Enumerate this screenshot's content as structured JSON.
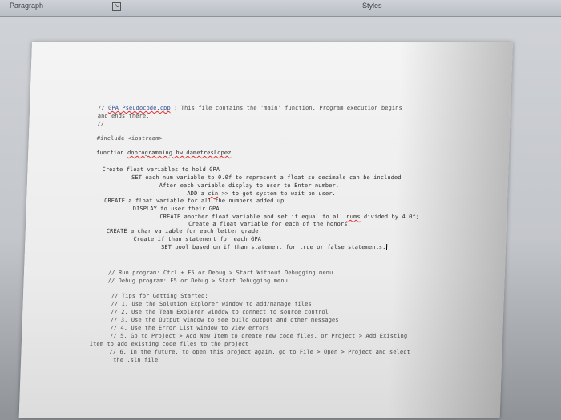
{
  "ribbon": {
    "paragraph_label": "Paragraph",
    "styles_label": "Styles",
    "launcher_icon": "dialog-launcher-icon"
  },
  "document": {
    "lines": [
      {
        "parts": [
          {
            "t": "// ",
            "c": "cmt"
          },
          {
            "t": "GPA Pseudocode.cpp",
            "c": "link"
          },
          {
            "t": " : This file contains the 'main' function. Program execution begins",
            "c": "cmt"
          }
        ]
      },
      {
        "parts": [
          {
            "t": "and ends there.",
            "c": "cmt"
          }
        ]
      },
      {
        "parts": [
          {
            "t": "//",
            "c": "cmt"
          }
        ]
      },
      {
        "parts": [
          {
            "t": "#include <iostream>",
            "c": "cmt"
          }
        ]
      },
      {
        "parts": [
          {
            "t": "function ",
            "c": ""
          },
          {
            "t": "doprogramming hw dametresLopez",
            "c": "sq"
          }
        ]
      },
      {
        "parts": [
          {
            "t": "Create float variables to hold GPA",
            "c": ""
          }
        ]
      },
      {
        "parts": [
          {
            "t": "SET each num variable to 0.0f to represent a float so decimals can be included",
            "c": ""
          }
        ]
      },
      {
        "parts": [
          {
            "t": "After each variable display to user to Enter number.",
            "c": ""
          }
        ]
      },
      {
        "parts": [
          {
            "t": "ADD a ",
            "c": ""
          },
          {
            "t": "cin",
            "c": "sq"
          },
          {
            "t": " >> to get system to wait on user.",
            "c": ""
          }
        ]
      },
      {
        "parts": [
          {
            "t": "CREATE a float variable for all the numbers added up",
            "c": ""
          }
        ]
      },
      {
        "parts": [
          {
            "t": "DISPLAY to user their GPA",
            "c": ""
          }
        ]
      },
      {
        "parts": [
          {
            "t": "CREATE another float variable and set it equal to all ",
            "c": ""
          },
          {
            "t": "nums",
            "c": "sq"
          },
          {
            "t": " divided by 4.0f;",
            "c": ""
          }
        ]
      },
      {
        "parts": [
          {
            "t": "Create a float variable for each of the honors.",
            "c": ""
          }
        ]
      },
      {
        "parts": [
          {
            "t": "CREATE a char variable for each letter grade.",
            "c": ""
          }
        ]
      },
      {
        "parts": [
          {
            "t": "Create if than statement for each GPA",
            "c": ""
          }
        ]
      },
      {
        "parts": [
          {
            "t": "SET bool based on if than statement for true or false statements.",
            "c": ""
          }
        ]
      },
      {
        "parts": [
          {
            "t": "// Run program: Ctrl + F5 or Debug > Start Without Debugging menu",
            "c": "cmt"
          }
        ]
      },
      {
        "parts": [
          {
            "t": "// Debug program: F5 or Debug > Start Debugging menu",
            "c": "cmt"
          }
        ]
      },
      {
        "parts": [
          {
            "t": "// Tips for Getting Started:",
            "c": "cmt"
          }
        ]
      },
      {
        "parts": [
          {
            "t": "//   1. Use the Solution Explorer window to add/manage files",
            "c": "cmt"
          }
        ]
      },
      {
        "parts": [
          {
            "t": "//   2. Use the Team Explorer window to connect to source control",
            "c": "cmt"
          }
        ]
      },
      {
        "parts": [
          {
            "t": "//   3. Use the Output window to see build output and other messages",
            "c": "cmt"
          }
        ]
      },
      {
        "parts": [
          {
            "t": "//   4. Use the Error List window to view errors",
            "c": "cmt"
          }
        ]
      },
      {
        "parts": [
          {
            "t": "//   5. Go to Project > Add New Item to create new code files, or Project > Add Existing",
            "c": "cmt"
          }
        ]
      },
      {
        "parts": [
          {
            "t": "Item to add existing code files to the project",
            "c": "cmt"
          }
        ]
      },
      {
        "parts": [
          {
            "t": "//   6. In the future, to open this project again, go to File > Open > Project and select",
            "c": "cmt"
          }
        ]
      },
      {
        "parts": [
          {
            "t": "the .sln file",
            "c": "cmt"
          }
        ]
      }
    ]
  }
}
